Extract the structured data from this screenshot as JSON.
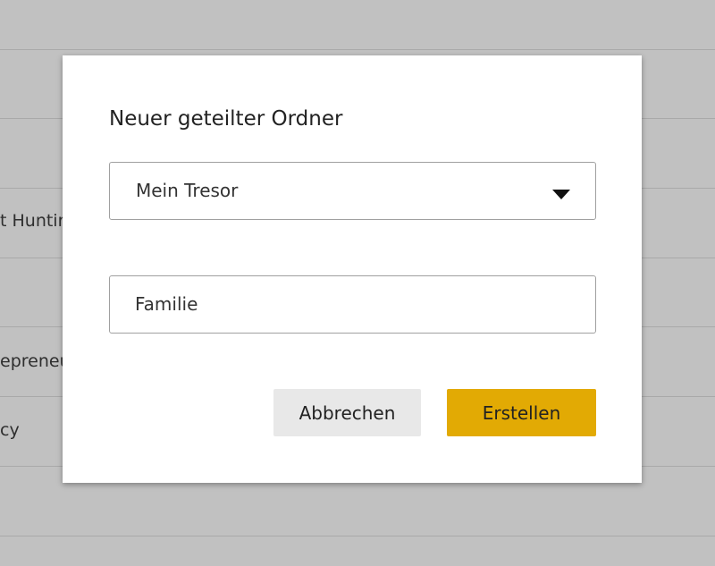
{
  "background": {
    "row_texts": [
      "t Huntir",
      "epreneu",
      "cy"
    ]
  },
  "dialog": {
    "title": "Neuer geteilter Ordner",
    "vault_select": {
      "value": "Mein Tresor"
    },
    "folder_name_input": {
      "value": "Familie"
    },
    "buttons": {
      "cancel_label": "Abbrechen",
      "create_label": "Erstellen"
    }
  },
  "colors": {
    "overlay": "#c1c1c1",
    "dialog_bg": "#ffffff",
    "primary_button": "#e2aa04",
    "secondary_button": "#e8e8e8"
  },
  "icons": {
    "select_caret": "caret-down-icon"
  }
}
